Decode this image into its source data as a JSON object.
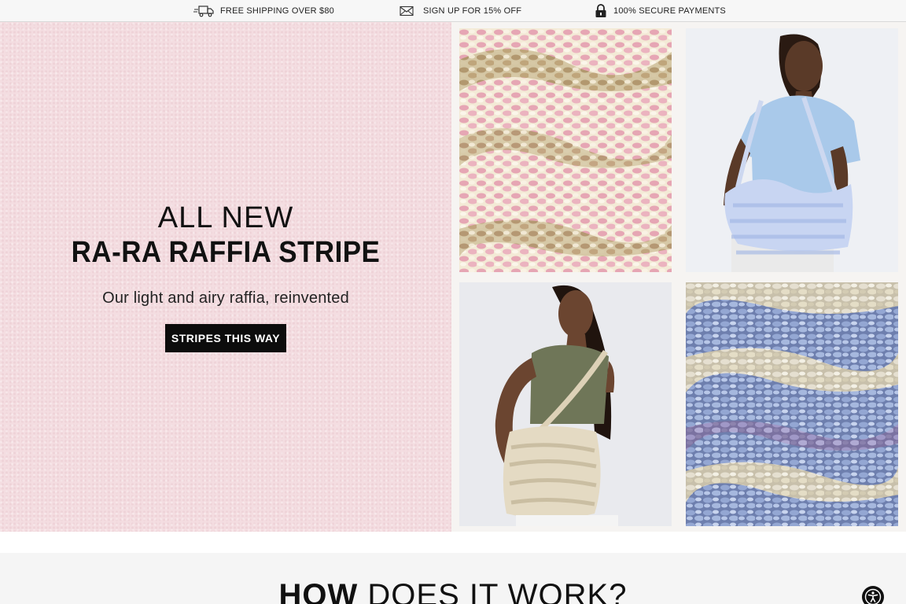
{
  "topbar": {
    "items": [
      {
        "icon": "truck-icon",
        "label": "FREE SHIPPING OVER $80"
      },
      {
        "icon": "envelope-icon",
        "label": "SIGN UP FOR 15% OFF"
      },
      {
        "icon": "lock-icon",
        "label": "100% SECURE PAYMENTS"
      }
    ]
  },
  "hero": {
    "eyebrow": "ALL NEW",
    "title": "RA-RA RAFFIA STRIPE",
    "subtitle": "Our light and airy raffia, reinvented",
    "cta_label": "STRIPES THIS WAY",
    "background_color": "#f4dde1",
    "tiles": [
      {
        "name": "pink-raffia-texture",
        "palette": [
          "#e7a9b6",
          "#f4ead7",
          "#b49a66"
        ]
      },
      {
        "name": "model-blue-bag",
        "palette": [
          "#a9c9ea",
          "#ccd6f0",
          "#3b2418"
        ]
      },
      {
        "name": "model-cream-bag",
        "palette": [
          "#6f7658",
          "#e4dac3",
          "#3b2418"
        ]
      },
      {
        "name": "blue-raffia-texture",
        "palette": [
          "#8fa2cf",
          "#f2e8cf",
          "#9e90c0"
        ]
      }
    ]
  },
  "how_section": {
    "title_bold": "HOW",
    "title_rest": "DOES IT WORK?"
  },
  "accessibility": {
    "icon": "accessibility-icon"
  }
}
